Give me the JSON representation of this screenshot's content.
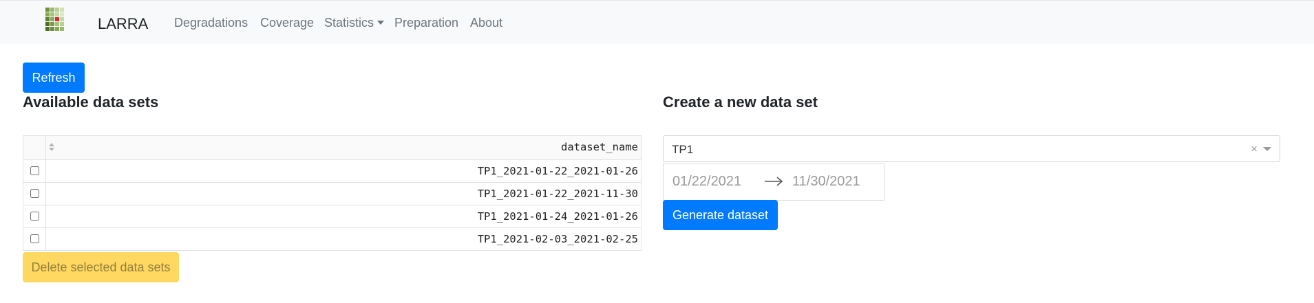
{
  "navbar": {
    "brand": "LARRA",
    "logo_icon": "larra-grid-logo",
    "links": {
      "degradations": "Degradations",
      "coverage": "Coverage",
      "statistics": "Statistics",
      "preparation": "Preparation",
      "about": "About"
    }
  },
  "actions": {
    "refresh_label": "Refresh"
  },
  "available": {
    "title": "Available data sets",
    "column_header": "dataset_name",
    "rows": [
      "TP1_2021-01-22_2021-01-26",
      "TP1_2021-01-22_2021-11-30",
      "TP1_2021-01-24_2021-01-26",
      "TP1_2021-02-03_2021-02-25"
    ],
    "delete_label": "Delete selected data sets"
  },
  "create": {
    "title": "Create a new data set",
    "selected_value": "TP1",
    "clear_symbol": "×",
    "date_start": "01/22/2021",
    "date_end": "11/30/2021",
    "generate_label": "Generate dataset"
  },
  "colors": {
    "primary": "#007bff",
    "warning": "#ffd862",
    "navbar_bg": "#f8f9fa"
  }
}
